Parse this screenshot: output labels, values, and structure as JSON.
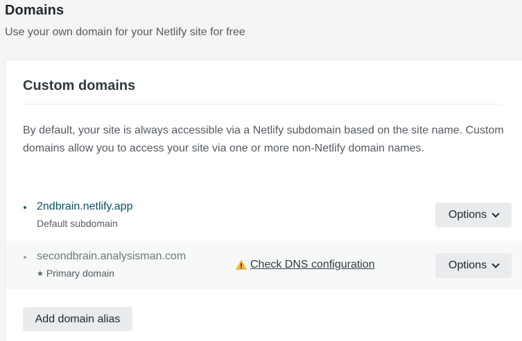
{
  "header": {
    "title": "Domains",
    "subtitle": "Use your own domain for your Netlify site for free"
  },
  "card": {
    "title": "Custom domains",
    "description": "By default, your site is always accessible via a Netlify subdomain based on the site name. Custom domains allow you to access your site via one or more non-Netlify domain names.",
    "domains": [
      {
        "name": "2ndbrain.netlify.app",
        "sub_label": "Default subdomain",
        "options_label": "Options"
      },
      {
        "name": "secondbrain.analysisman.com",
        "sub_label": "Primary domain",
        "sub_icon": "star-icon",
        "warning_link": "Check DNS configuration",
        "warning_icon": "warning-icon",
        "options_label": "Options"
      }
    ],
    "add_alias_label": "Add domain alias"
  },
  "colors": {
    "link_teal": "#0b5260",
    "warning_yellow": "#f6b73c",
    "button_gray": "#e9ebed"
  }
}
